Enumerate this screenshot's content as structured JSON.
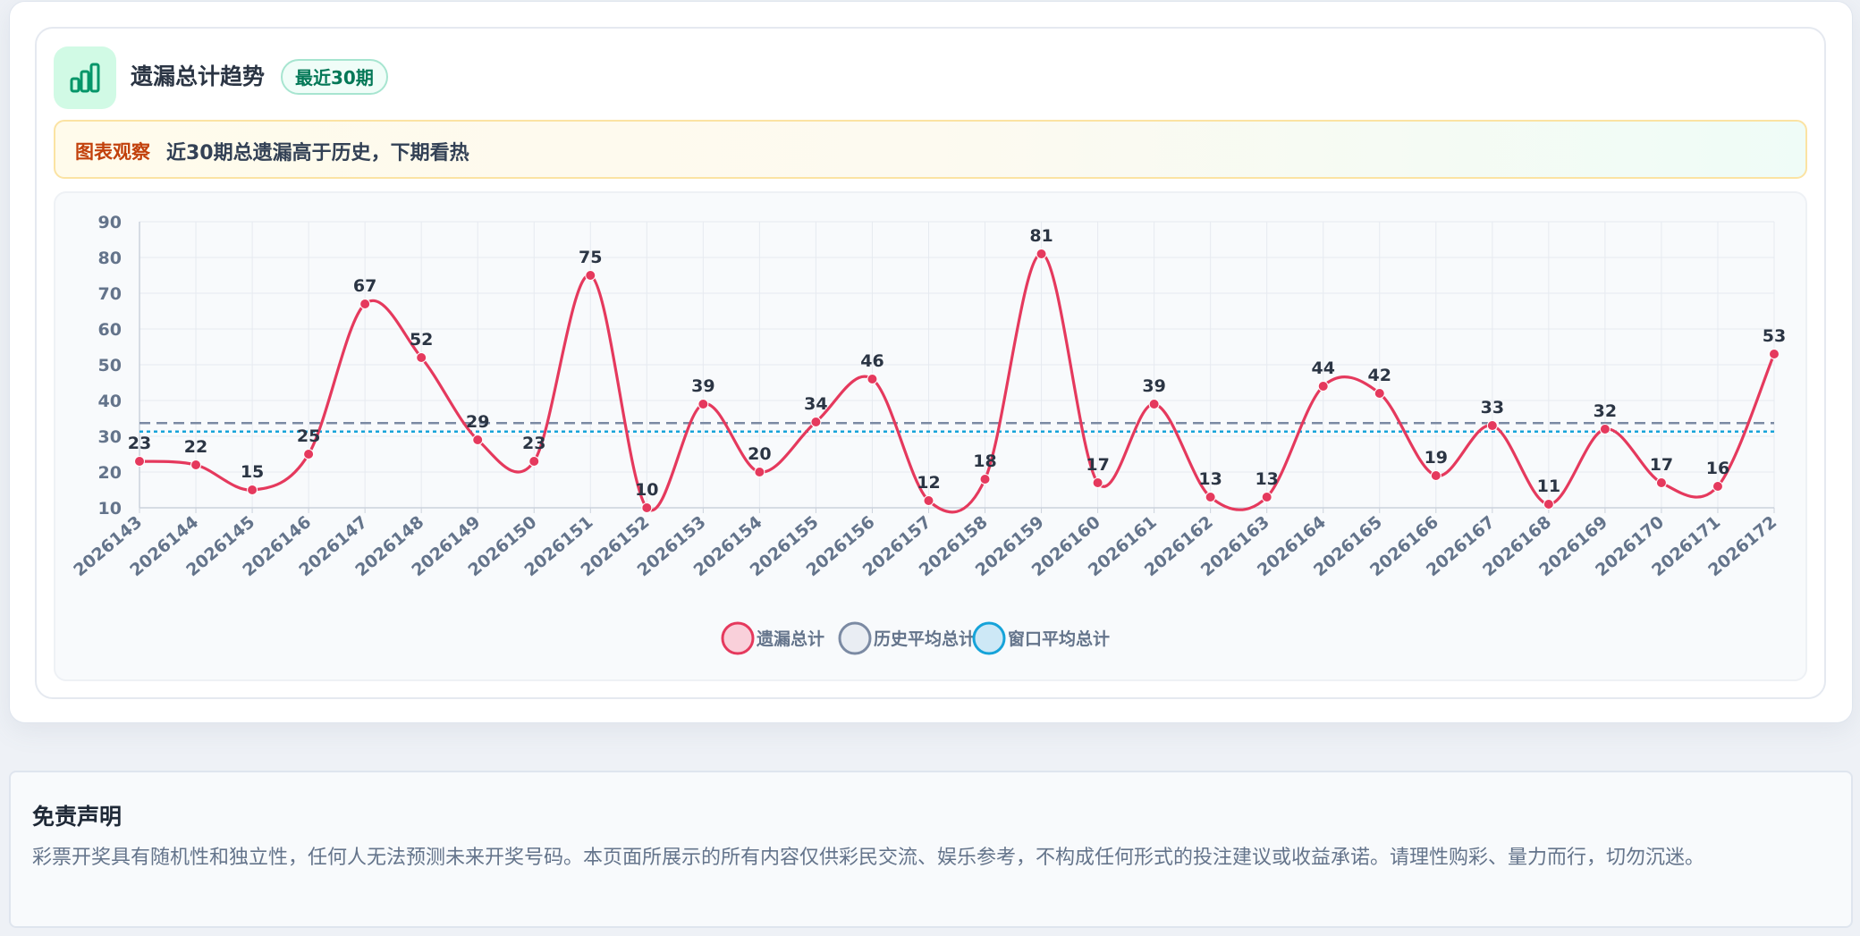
{
  "header": {
    "icon": "bar-chart-icon",
    "title": "遗漏总计趋势",
    "badge": "最近30期"
  },
  "observation": {
    "label": "图表观察",
    "text": "近30期总遗漏高于历史，下期看热"
  },
  "colors": {
    "series": "#e5395d",
    "history_avg": "#7b8aa3",
    "window_avg": "#16a3d9",
    "accent_green": "#047857"
  },
  "chart_data": {
    "type": "line",
    "categories": [
      "2026143",
      "2026144",
      "2026145",
      "2026146",
      "2026147",
      "2026148",
      "2026149",
      "2026150",
      "2026151",
      "2026152",
      "2026153",
      "2026154",
      "2026155",
      "2026156",
      "2026157",
      "2026158",
      "2026159",
      "2026160",
      "2026161",
      "2026162",
      "2026163",
      "2026164",
      "2026165",
      "2026166",
      "2026167",
      "2026168",
      "2026169",
      "2026170",
      "2026171",
      "2026172"
    ],
    "series": [
      {
        "name": "遗漏总计",
        "values": [
          23,
          22,
          15,
          25,
          67,
          52,
          29,
          23,
          75,
          10,
          39,
          20,
          34,
          46,
          12,
          18,
          81,
          17,
          39,
          13,
          13,
          44,
          42,
          19,
          33,
          11,
          32,
          17,
          16,
          53
        ],
        "color": "#e5395d",
        "smooth": true,
        "data_labels": true
      }
    ],
    "reference_lines": [
      {
        "name": "历史平均总计",
        "value": 33.7,
        "style": "dashed",
        "color": "#7b8aa3"
      },
      {
        "name": "窗口平均总计",
        "value": 31.3,
        "style": "dotted",
        "color": "#16a3d9"
      }
    ],
    "yticks": [
      10,
      20,
      30,
      40,
      50,
      60,
      70,
      80,
      90
    ],
    "ylim": [
      10,
      90
    ],
    "grid": true,
    "legend": "bottom-center",
    "legend_items": [
      "遗漏总计",
      "历史平均总计",
      "窗口平均总计"
    ]
  },
  "disclaimer": {
    "title": "免责声明",
    "text": "彩票开奖具有随机性和独立性，任何人无法预测未来开奖号码。本页面所展示的所有内容仅供彩民交流、娱乐参考，不构成任何形式的投注建议或收益承诺。请理性购彩、量力而行，切勿沉迷。"
  }
}
